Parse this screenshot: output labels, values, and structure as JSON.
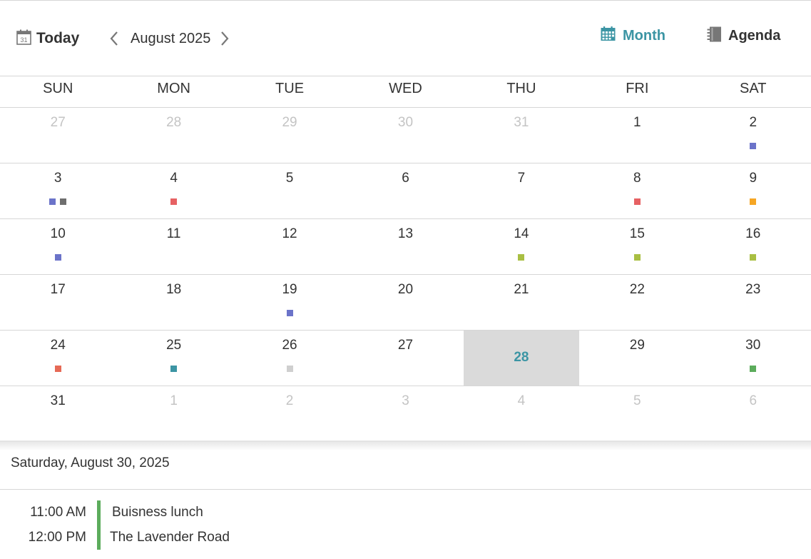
{
  "toolbar": {
    "today_label": "Today",
    "period_title": "August 2025",
    "month_label": "Month",
    "agenda_label": "Agenda",
    "calendar_icon_day": "31",
    "active_view": "Month"
  },
  "colors": {
    "accent": "#3c95a4",
    "today_bg": "#dadada",
    "event_bar": "#5cac5c"
  },
  "weekdays": [
    "SUN",
    "MON",
    "TUE",
    "WED",
    "THU",
    "FRI",
    "SAT"
  ],
  "weeks": [
    [
      {
        "n": "27",
        "other": true,
        "dots": []
      },
      {
        "n": "28",
        "other": true,
        "dots": []
      },
      {
        "n": "29",
        "other": true,
        "dots": []
      },
      {
        "n": "30",
        "other": true,
        "dots": []
      },
      {
        "n": "31",
        "other": true,
        "dots": []
      },
      {
        "n": "1",
        "dots": []
      },
      {
        "n": "2",
        "dots": [
          "#6b73c9"
        ]
      }
    ],
    [
      {
        "n": "3",
        "dots": [
          "#6b73c9",
          "#6e6e6e"
        ]
      },
      {
        "n": "4",
        "dots": [
          "#e66163"
        ]
      },
      {
        "n": "5",
        "dots": []
      },
      {
        "n": "6",
        "dots": []
      },
      {
        "n": "7",
        "dots": []
      },
      {
        "n": "8",
        "dots": [
          "#e66163"
        ]
      },
      {
        "n": "9",
        "dots": [
          "#f6a624"
        ]
      }
    ],
    [
      {
        "n": "10",
        "dots": [
          "#6b73c9"
        ]
      },
      {
        "n": "11",
        "dots": []
      },
      {
        "n": "12",
        "dots": []
      },
      {
        "n": "13",
        "dots": []
      },
      {
        "n": "14",
        "dots": [
          "#a9bf43"
        ]
      },
      {
        "n": "15",
        "dots": [
          "#a9bf43"
        ]
      },
      {
        "n": "16",
        "dots": [
          "#a9bf43"
        ]
      }
    ],
    [
      {
        "n": "17",
        "dots": []
      },
      {
        "n": "18",
        "dots": []
      },
      {
        "n": "19",
        "dots": [
          "#6b73c9"
        ]
      },
      {
        "n": "20",
        "dots": []
      },
      {
        "n": "21",
        "dots": []
      },
      {
        "n": "22",
        "dots": []
      },
      {
        "n": "23",
        "dots": []
      }
    ],
    [
      {
        "n": "24",
        "dots": [
          "#e66a56"
        ]
      },
      {
        "n": "25",
        "dots": [
          "#3c95a4"
        ]
      },
      {
        "n": "26",
        "dots": [
          "#cfcfcf"
        ]
      },
      {
        "n": "27",
        "dots": []
      },
      {
        "n": "28",
        "today": true,
        "dots": []
      },
      {
        "n": "29",
        "dots": []
      },
      {
        "n": "30",
        "dots": [
          "#5cac5c"
        ]
      }
    ],
    [
      {
        "n": "31",
        "dots": []
      },
      {
        "n": "1",
        "other": true,
        "dots": []
      },
      {
        "n": "2",
        "other": true,
        "dots": []
      },
      {
        "n": "3",
        "other": true,
        "dots": []
      },
      {
        "n": "4",
        "other": true,
        "dots": []
      },
      {
        "n": "5",
        "other": true,
        "dots": []
      },
      {
        "n": "6",
        "other": true,
        "dots": []
      }
    ]
  ],
  "agenda": {
    "selected_date": "Saturday, August 30, 2025",
    "events": [
      {
        "time": "11:00 AM",
        "title": "Buisness lunch"
      },
      {
        "time": "12:00 PM",
        "title": "The Lavender Road"
      }
    ]
  }
}
